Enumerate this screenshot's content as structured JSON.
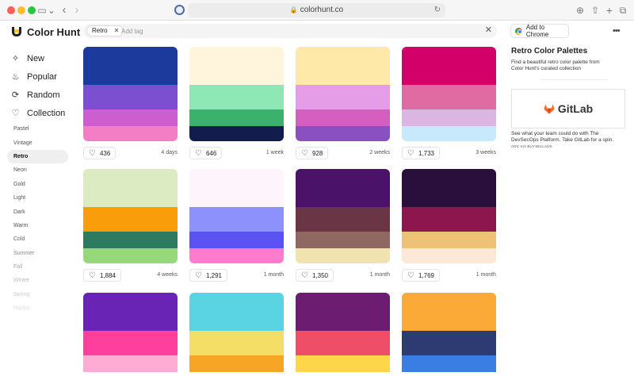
{
  "browser": {
    "url": "colorhunt.co",
    "lock_glyph": "🔒",
    "reload_glyph": "↻",
    "controls": {
      "sidebar": "▭",
      "down": "⌄",
      "back": "‹",
      "forward": "›",
      "download": "⊕",
      "share": "⇧",
      "new_tab": "+",
      "tabs": "⧉"
    }
  },
  "brand": {
    "name": "Color Hunt"
  },
  "nav": [
    {
      "label": "New",
      "icon": "sparkle-icon",
      "glyph": "✧"
    },
    {
      "label": "Popular",
      "icon": "flame-icon",
      "glyph": "♨"
    },
    {
      "label": "Random",
      "icon": "shuffle-icon",
      "glyph": "⟳"
    },
    {
      "label": "Collection",
      "icon": "heart-icon",
      "glyph": "♡"
    }
  ],
  "tags": [
    {
      "label": "Pastel",
      "color": "#555555"
    },
    {
      "label": "Vintage",
      "color": "#555555"
    },
    {
      "label": "Retro",
      "color": "#111111"
    },
    {
      "label": "Neon",
      "color": "#555555"
    },
    {
      "label": "Gold",
      "color": "#555555"
    },
    {
      "label": "Light",
      "color": "#555555"
    },
    {
      "label": "Dark",
      "color": "#555555"
    },
    {
      "label": "Warm",
      "color": "#555555"
    },
    {
      "label": "Cold",
      "color": "#666666"
    },
    {
      "label": "Summer",
      "color": "#8a8a8a"
    },
    {
      "label": "Fall",
      "color": "#a8a8a8"
    },
    {
      "label": "Winter",
      "color": "#bcbcbc"
    },
    {
      "label": "Spring",
      "color": "#cdcdcd"
    },
    {
      "label": "Happy",
      "color": "#dddddd"
    }
  ],
  "active_tag": "Retro",
  "search": {
    "chip": "Retro",
    "chip_close": "✕",
    "placeholder": "Add tag",
    "value": "",
    "clear": "✕"
  },
  "palettes": [
    {
      "colors": [
        "#1b3a9c",
        "#7b4fd0",
        "#cc5ed0",
        "#f47ec6"
      ],
      "likes": "436",
      "age": "4 days"
    },
    {
      "colors": [
        "#fff4dc",
        "#8ee8b6",
        "#3ab26b",
        "#121d4e"
      ],
      "likes": "646",
      "age": "1 week"
    },
    {
      "colors": [
        "#ffe9a8",
        "#e59de8",
        "#d55fc0",
        "#8a4fc0"
      ],
      "likes": "928",
      "age": "2 weeks"
    },
    {
      "colors": [
        "#d3006a",
        "#e06aa2",
        "#dcb6e2",
        "#c8e8fb"
      ],
      "likes": "1,733",
      "age": "3 weeks"
    },
    {
      "colors": [
        "#dcebc2",
        "#f99e0a",
        "#2d7a5e",
        "#97d87a"
      ],
      "likes": "1,884",
      "age": "4 weeks"
    },
    {
      "colors": [
        "#fdf5fb",
        "#8d91fb",
        "#5b52f3",
        "#ff7bd0"
      ],
      "likes": "1,291",
      "age": "1 month"
    },
    {
      "colors": [
        "#4a1268",
        "#6a3545",
        "#8f6862",
        "#f1e3b0"
      ],
      "likes": "1,350",
      "age": "1 month"
    },
    {
      "colors": [
        "#2a0e3c",
        "#8d164f",
        "#edc276",
        "#fde8d8"
      ],
      "likes": "1,769",
      "age": "1 month"
    },
    {
      "colors": [
        "#6a24b5",
        "#ff3f9e",
        "#ffacd5",
        "#ffffff"
      ],
      "likes": "",
      "age": ""
    },
    {
      "colors": [
        "#5ad4e3",
        "#f4de65",
        "#f6a524",
        "#ffffff"
      ],
      "likes": "",
      "age": ""
    },
    {
      "colors": [
        "#6c1d72",
        "#ef4e69",
        "#fdd64a",
        "#ffffff"
      ],
      "likes": "",
      "age": ""
    },
    {
      "colors": [
        "#fba937",
        "#2e3a72",
        "#3b7ee3",
        "#ffffff"
      ],
      "likes": "",
      "age": ""
    }
  ],
  "right_panel": {
    "add_to_chrome": "Add to Chrome",
    "more": "•••",
    "title": "Retro Color Palettes",
    "description": "Find a beautiful retro color palette from Color Hunt's curated collection",
    "ad_brand": "GitLab",
    "ad_copy": "See what your team could do with The DevSecOps Platform. Take GitLab for a spin.",
    "ad_via": "ADS VIA BUYSELLADS"
  },
  "colors": {
    "gitlab_orange": "#fc6d26",
    "gitlab_red": "#e24329",
    "gitlab_yellow": "#fca326"
  }
}
